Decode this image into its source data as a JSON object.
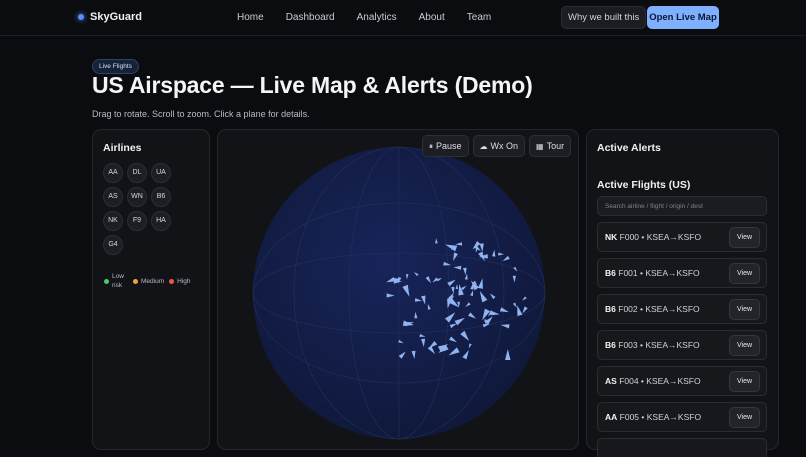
{
  "header": {
    "brand": "SkyGuard",
    "nav": [
      "Home",
      "Dashboard",
      "Analytics",
      "About",
      "Team"
    ],
    "why_button": "Why we built this",
    "open_button": "Open Live Map"
  },
  "hero": {
    "badge": "Live Flights",
    "title": "US Airspace — Live Map & Alerts (Demo)",
    "subtitle": "Drag to rotate. Scroll to zoom. Click a plane for details."
  },
  "airlines": {
    "title": "Airlines",
    "codes": [
      "AA",
      "DL",
      "UA",
      "AS",
      "WN",
      "B6",
      "NK",
      "F9",
      "HA",
      "G4"
    ],
    "legend": [
      {
        "label": "Low risk",
        "color": "#4ccb6a"
      },
      {
        "label": "Medium",
        "color": "#f2a23a"
      },
      {
        "label": "High",
        "color": "#f0564a"
      }
    ]
  },
  "map": {
    "controls": [
      {
        "icon": "pause-icon",
        "label": "Pause"
      },
      {
        "icon": "cloud-icon",
        "label": "Wx On"
      },
      {
        "icon": "tour-icon",
        "label": "Tour"
      }
    ],
    "globe_color": "#131d44",
    "plane_color": "#8fb4f0"
  },
  "alerts": {
    "title": "Active Alerts",
    "flights_title": "Active Flights (US)",
    "search_placeholder": "Search airline / flight / origin / dest",
    "view_label": "View",
    "flights": [
      {
        "airline": "NK",
        "flight": "F000",
        "route": "KSEA→KSFO"
      },
      {
        "airline": "B6",
        "flight": "F001",
        "route": "KSEA→KSFO"
      },
      {
        "airline": "B6",
        "flight": "F002",
        "route": "KSEA→KSFO"
      },
      {
        "airline": "B6",
        "flight": "F003",
        "route": "KSEA→KSFO"
      },
      {
        "airline": "AS",
        "flight": "F004",
        "route": "KSEA→KSFO"
      },
      {
        "airline": "AA",
        "flight": "F005",
        "route": "KSEA→KSFO"
      }
    ]
  }
}
